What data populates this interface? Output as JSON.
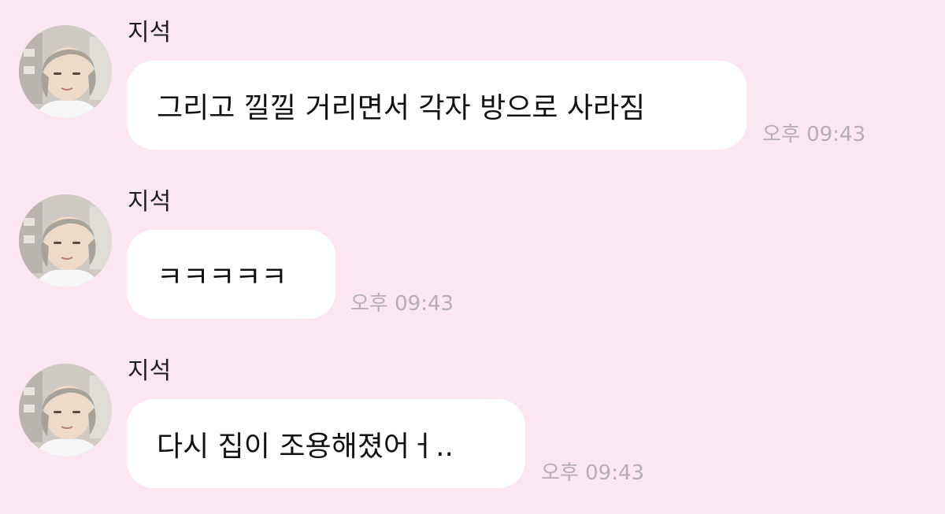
{
  "messages": [
    {
      "sender": "지석",
      "text": "그리고 낄낄 거리면서 각자 방으로 사라짐",
      "time": "오후 09:43"
    },
    {
      "sender": "지석",
      "text": "ㅋㅋㅋㅋㅋ",
      "time": "오후 09:43"
    },
    {
      "sender": "지석",
      "text": "다시 집이 조용해졌어ㅓ..",
      "time": "오후 09:43"
    }
  ],
  "colors": {
    "background": "#fbe6f2",
    "bubble": "#ffffff",
    "timestamp": "#b6aeb3"
  }
}
